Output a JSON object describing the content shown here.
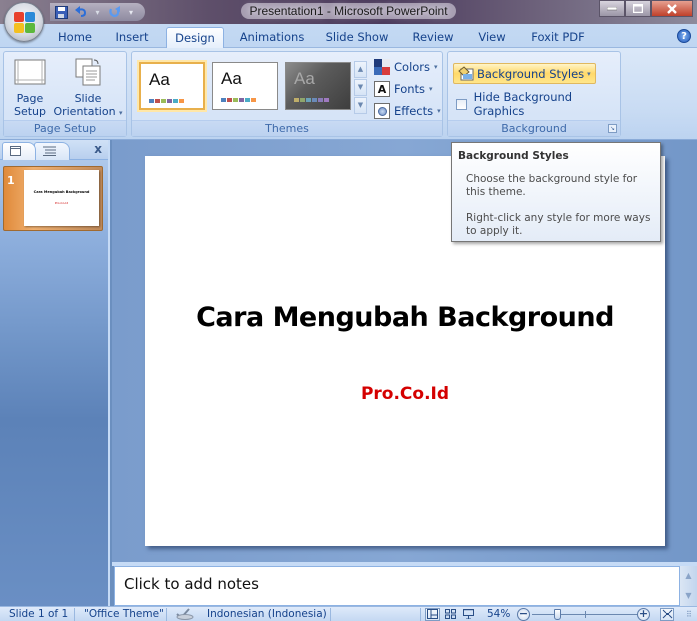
{
  "window": {
    "title": "Presentation1 - Microsoft PowerPoint",
    "controls": [
      "minimize",
      "restore",
      "close"
    ]
  },
  "qat": {
    "items": [
      {
        "name": "save-icon",
        "glyph": "💾"
      },
      {
        "name": "undo-icon",
        "glyph": "↶"
      },
      {
        "name": "undo-dropdown-icon",
        "glyph": "▾"
      },
      {
        "name": "redo-icon",
        "glyph": "↻"
      },
      {
        "name": "customize-qat-icon",
        "glyph": "▾"
      }
    ]
  },
  "tabs": [
    {
      "label": "Home",
      "active": false
    },
    {
      "label": "Insert",
      "active": false
    },
    {
      "label": "Design",
      "active": true
    },
    {
      "label": "Animations",
      "active": false
    },
    {
      "label": "Slide Show",
      "active": false
    },
    {
      "label": "Review",
      "active": false
    },
    {
      "label": "View",
      "active": false
    },
    {
      "label": "Foxit PDF",
      "active": false
    }
  ],
  "help": {
    "glyph": "?"
  },
  "ribbon": {
    "page_setup": {
      "label": "Page Setup",
      "page_setup_btn": {
        "line1": "Page",
        "line2": "Setup"
      },
      "orientation_btn": {
        "line1": "Slide",
        "line2": "Orientation",
        "arrow": "▾"
      }
    },
    "themes": {
      "label": "Themes",
      "thumbs": [
        {
          "text": "Aa",
          "style": "office",
          "selected": true,
          "swatches": [
            "#4f81bd",
            "#c0504d",
            "#9bbb59",
            "#8064a2",
            "#4bacc6",
            "#f79646"
          ]
        },
        {
          "text": "Aa",
          "style": "office-light",
          "selected": false,
          "swatches": [
            "#4f81bd",
            "#c0504d",
            "#9bbb59",
            "#8064a2",
            "#4bacc6",
            "#f79646"
          ]
        },
        {
          "text": "Aa",
          "style": "dark",
          "selected": false,
          "swatches": [
            "#bfae6a",
            "#8fa66c",
            "#6aa2b8",
            "#6a8ab8",
            "#8a7ab8",
            "#a07ac0"
          ]
        }
      ],
      "scroll": {
        "up": "▲",
        "down": "▼",
        "more": "▼"
      },
      "colors_label": "Colors",
      "fonts_label": "Fonts",
      "fonts_glyph": "A",
      "effects_label": "Effects",
      "arrow": "▾"
    },
    "background": {
      "label": "Background",
      "styles_btn": "Background Styles",
      "styles_arrow": "▾",
      "hide_graphics_label": "Hide Background Graphics",
      "hide_graphics_checked": false,
      "launcher": "↘"
    }
  },
  "tooltip": {
    "title": "Background Styles",
    "p1": "Choose the background style for this theme.",
    "p2": "Right-click any style for more ways to apply it."
  },
  "left_pane": {
    "close": "x",
    "slides": [
      {
        "number": "1",
        "title": "Cara Mengubah Background",
        "subtitle": "Pro.Co.Id"
      }
    ]
  },
  "slide": {
    "title": "Cara Mengubah Background",
    "subtitle": "Pro.Co.Id",
    "title_color": "#000000",
    "subtitle_color": "#d40000"
  },
  "notes": {
    "placeholder": "Click to add notes"
  },
  "status": {
    "slide_counter": "Slide 1 of 1",
    "theme": "\"Office Theme\"",
    "language": "Indonesian (Indonesia)",
    "zoom": "54%",
    "zoom_percent": 54,
    "views": [
      "normal-view",
      "slide-sorter-view",
      "slide-show-view"
    ],
    "zoom_out": "−",
    "zoom_in": "+"
  }
}
